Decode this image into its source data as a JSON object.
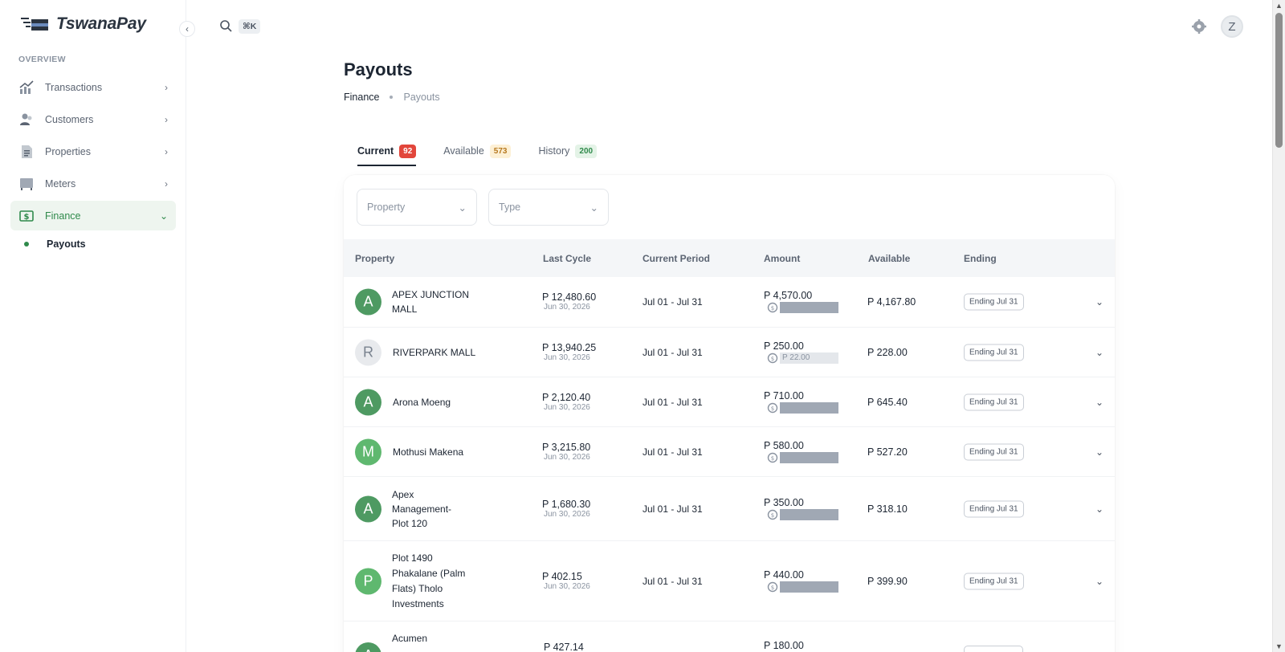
{
  "app": {
    "name": "TswanaPay"
  },
  "sidebar": {
    "section_label": "OVERVIEW",
    "items": [
      {
        "label": "Transactions",
        "icon": "chart-icon"
      },
      {
        "label": "Customers",
        "icon": "users-icon"
      },
      {
        "label": "Properties",
        "icon": "document-icon"
      },
      {
        "label": "Meters",
        "icon": "meter-icon"
      },
      {
        "label": "Finance",
        "icon": "dollar-icon"
      }
    ],
    "sub_items": [
      {
        "label": "Payouts"
      }
    ]
  },
  "topbar": {
    "shortcut": "⌘K",
    "avatar_initial": "Z"
  },
  "page": {
    "title": "Payouts",
    "breadcrumb": [
      "Finance",
      "Payouts"
    ]
  },
  "tabs": [
    {
      "label": "Current",
      "count": "92"
    },
    {
      "label": "Available",
      "count": "573"
    },
    {
      "label": "History",
      "count": "200"
    }
  ],
  "filters": {
    "property": "Property",
    "type": "Type"
  },
  "table": {
    "headers": [
      "Property",
      "Last Cycle",
      "Current Period",
      "Amount",
      "Available",
      "Ending"
    ],
    "rows": [
      {
        "initial": "A",
        "name": "APEX JUNCTION MALL",
        "last_cycle": "P 12,480.60",
        "cycle_date": "Jun 30, 2026",
        "period": "Jul 01 - Jul 31",
        "amount": "P 4,570.00",
        "bar_text": "",
        "available": "P 4,167.80",
        "ending": "Ending Jul 31"
      },
      {
        "initial": "R",
        "name": "RIVERPARK MALL",
        "last_cycle": "P 13,940.25",
        "cycle_date": "Jun 30, 2026",
        "period": "Jul 01 - Jul 31",
        "amount": "P 250.00",
        "bar_text": "P 22.00",
        "available": "P 228.00",
        "ending": "Ending Jul 31"
      },
      {
        "initial": "A",
        "name": "Arona Moeng",
        "last_cycle": "P 2,120.40",
        "cycle_date": "Jun 30, 2026",
        "period": "Jul 01 - Jul 31",
        "amount": "P 710.00",
        "bar_text": "",
        "available": "P 645.40",
        "ending": "Ending Jul 31"
      },
      {
        "initial": "M",
        "name": "Mothusi Makena",
        "last_cycle": "P 3,215.80",
        "cycle_date": "Jun 30, 2026",
        "period": "Jul 01 - Jul 31",
        "amount": "P 580.00",
        "bar_text": "",
        "available": "P 527.20",
        "ending": "Ending Jul 31"
      },
      {
        "initial": "A",
        "name": "Apex Management- Plot 120",
        "last_cycle": "P 1,680.30",
        "cycle_date": "Jun 30, 2026",
        "period": "Jul 01 - Jul 31",
        "amount": "P 350.00",
        "bar_text": "",
        "available": "P 318.10",
        "ending": "Ending Jul 31"
      },
      {
        "initial": "P",
        "name": "Plot 1490 Phakalane (Palm Flats) Tholo Investments",
        "last_cycle": "P 402.15",
        "cycle_date": "Jun 30, 2026",
        "period": "Jul 01 - Jul 31",
        "amount": "P 440.00",
        "bar_text": "",
        "available": "P 399.90",
        "ending": "Ending Jul 31"
      },
      {
        "initial": "A",
        "name": "Acumen",
        "last_cycle": "P 427.14",
        "cycle_date": "",
        "period": "",
        "amount": "P 180.00",
        "bar_text": "",
        "available": "",
        "ending": ""
      }
    ]
  },
  "colors": {
    "accent": "#2f8a4b",
    "badge_red": "#e2463b"
  }
}
